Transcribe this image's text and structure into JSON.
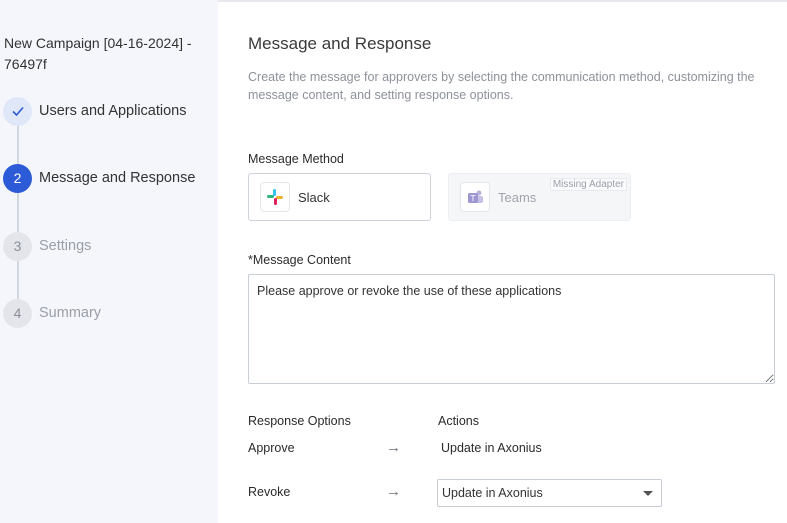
{
  "campaign": {
    "title": "New Campaign [04-16-2024] - 76497f"
  },
  "steps": [
    {
      "number": "✓",
      "label": "Users and Applications"
    },
    {
      "number": "2",
      "label": "Message and Response"
    },
    {
      "number": "3",
      "label": "Settings"
    },
    {
      "number": "4",
      "label": "Summary"
    }
  ],
  "main": {
    "title": "Message and Response",
    "description": "Create the message for approvers by selecting the communication method, customizing the message content, and setting response options.",
    "method_label": "Message Method",
    "methods": [
      {
        "name": "Slack",
        "icon": "slack-icon"
      },
      {
        "name": "Teams",
        "icon": "teams-icon",
        "badge": "Missing Adapter"
      }
    ],
    "content_label": "*Message Content",
    "content_value": "Please approve or revoke the use of these applications",
    "response_header": "Response Options",
    "actions_header": "Actions",
    "responses": [
      {
        "option": "Approve",
        "action": "Update in Axonius"
      },
      {
        "option": "Revoke",
        "action": "Update in Axonius"
      }
    ],
    "arrow": "→"
  },
  "colors": {
    "accent": "#2d5bd7",
    "sidebar_bg": "#f4f6fb"
  }
}
